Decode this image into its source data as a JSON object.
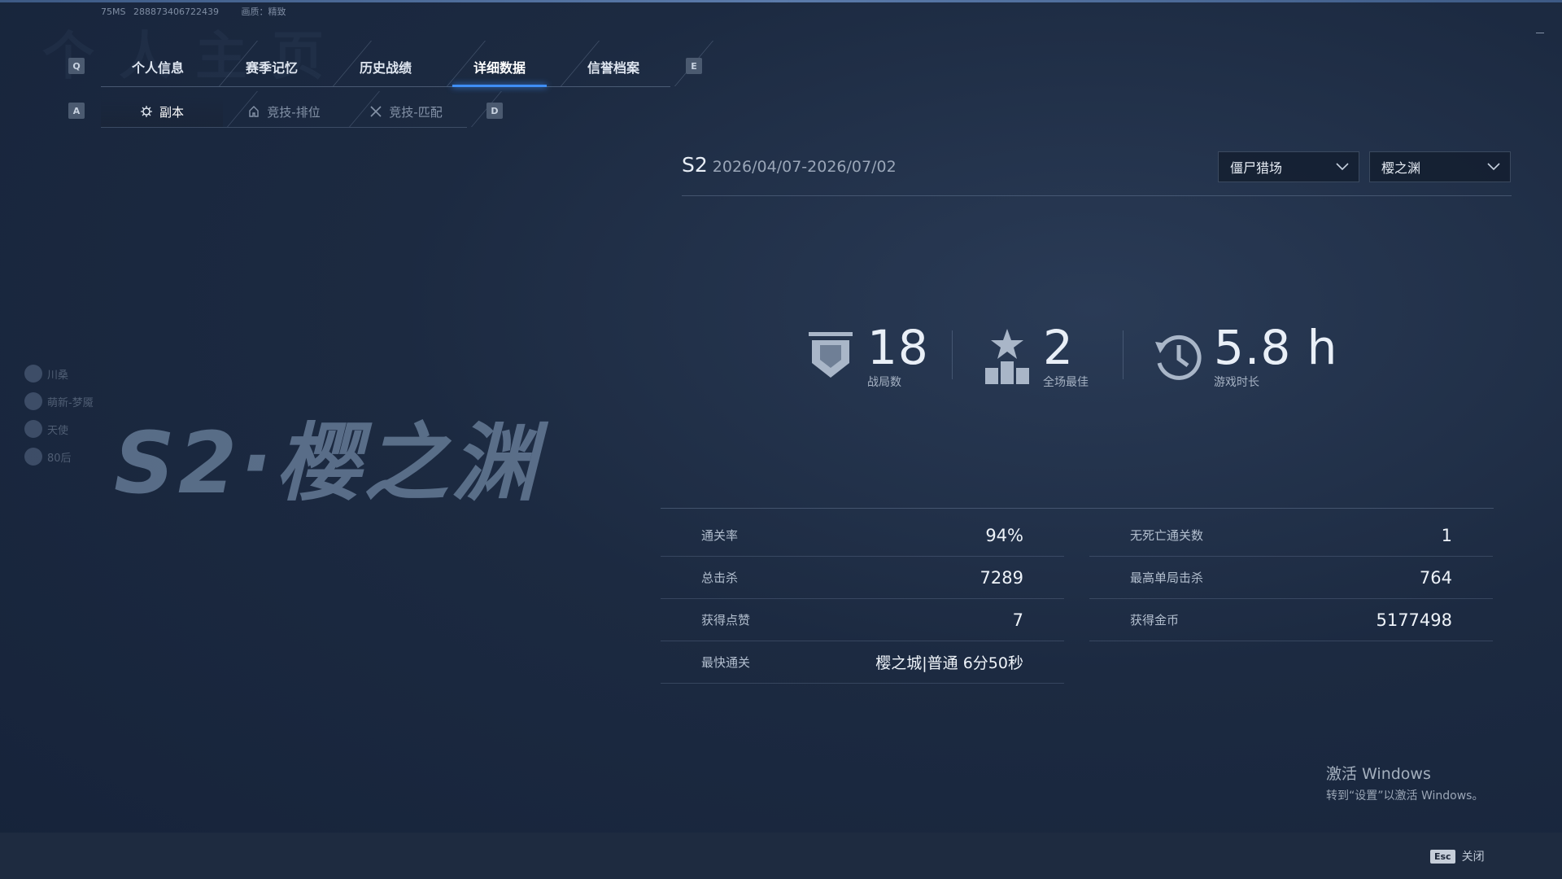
{
  "header": {
    "ping": "75MS",
    "uid": "288873406722439",
    "quality_label": "画质：精致"
  },
  "keys": {
    "tab_prev": "Q",
    "tab_next": "E",
    "sub_prev": "A",
    "sub_next": "D",
    "close": "Esc"
  },
  "tabs": [
    {
      "label": "个人信息"
    },
    {
      "label": "赛季记忆"
    },
    {
      "label": "历史战绩"
    },
    {
      "label": "详细数据",
      "active": true
    },
    {
      "label": "信誉档案"
    }
  ],
  "subtabs": [
    {
      "label": "副本",
      "icon": "dungeon-icon",
      "active": true
    },
    {
      "label": "竞技-排位",
      "icon": "rank-icon"
    },
    {
      "label": "竞技-匹配",
      "icon": "swords-icon"
    }
  ],
  "season": {
    "name": "S2",
    "range": "2026/04/07-2026/07/02"
  },
  "filters": {
    "mode": "僵尸猎场",
    "map": "樱之渊"
  },
  "big_title": "S2·樱之渊",
  "friends": [
    "川桑",
    "萌新-梦魇",
    "天使",
    "80后"
  ],
  "summary": {
    "matches": {
      "value": "18",
      "label": "战局数",
      "icon": "shield-icon"
    },
    "mvp": {
      "value": "2",
      "label": "全场最佳",
      "icon": "star-podium-icon"
    },
    "playtime": {
      "value": "5.8 h",
      "label": "游戏时长",
      "icon": "clock-icon"
    }
  },
  "stats_left": [
    {
      "label": "通关率",
      "value": "94%"
    },
    {
      "label": "总击杀",
      "value": "7289"
    },
    {
      "label": "获得点赞",
      "value": "7"
    },
    {
      "label": "最快通关",
      "value": "樱之城|普通 6分50秒"
    }
  ],
  "stats_right": [
    {
      "label": "无死亡通关数",
      "value": "1"
    },
    {
      "label": "最高单局击杀",
      "value": "764"
    },
    {
      "label": "获得金币",
      "value": "5177498"
    }
  ],
  "windows_activation": {
    "title": "激活 Windows",
    "subtitle": "转到“设置”以激活 Windows。"
  },
  "footer": {
    "close_label": "关闭"
  },
  "colors": {
    "accent": "#3f8ef5",
    "background": "#1c2a41"
  }
}
